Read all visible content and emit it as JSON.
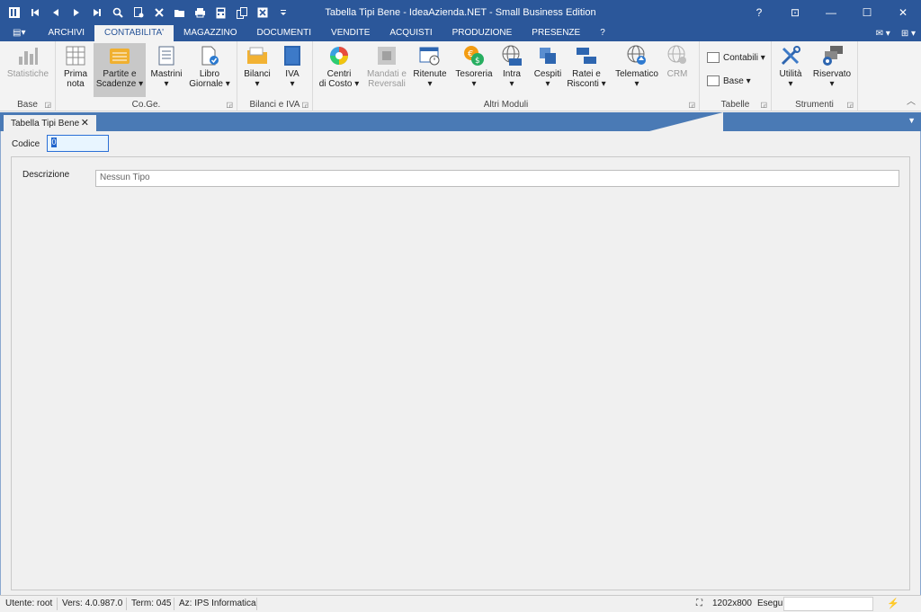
{
  "window": {
    "title": "Tabella Tipi Bene - IdeaAzienda.NET - Small Business Edition",
    "controls": [
      "?",
      "⊡",
      "—",
      "☐",
      "✕"
    ]
  },
  "quick_access": {
    "icons": [
      "app-icon",
      "first-icon",
      "prev-icon",
      "next-icon",
      "last-icon",
      "search-icon",
      "new-icon",
      "delete-icon",
      "folder-icon",
      "print-icon",
      "calc-icon",
      "copy-icon",
      "excel-icon",
      "customize-icon"
    ]
  },
  "ribbon_tabs": {
    "menu_glyph": "▤▾",
    "items": [
      "ARCHIVI",
      "CONTABILITA'",
      "MAGAZZINO",
      "DOCUMENTI",
      "VENDITE",
      "ACQUISTI",
      "PRODUZIONE",
      "PRESENZE",
      "?"
    ],
    "active": "CONTABILITA'",
    "right": [
      "✉ ▾",
      "⊞ ▾"
    ]
  },
  "ribbon": {
    "base": {
      "label": "Base",
      "statistiche": "Statistiche"
    },
    "coge": {
      "label": "Co.Ge.",
      "prima_nota_1": "Prima",
      "prima_nota_2": "nota",
      "partite_1": "Partite e",
      "partite_2": "Scadenze ▾",
      "mastrini_1": "Mastrini",
      "mastrini_2": "▾",
      "libro_1": "Libro",
      "libro_2": "Giornale ▾"
    },
    "bilanci_iva": {
      "label": "Bilanci e IVA",
      "bilanci_1": "Bilanci",
      "bilanci_2": "▾",
      "iva_1": "IVA",
      "iva_2": "▾"
    },
    "altri_moduli": {
      "label": "Altri Moduli",
      "centri_1": "Centri",
      "centri_2": "di Costo ▾",
      "mandati_1": "Mandati e",
      "mandati_2": "Reversali",
      "ritenute_1": "Ritenute",
      "ritenute_2": "▾",
      "tesoreria_1": "Tesoreria",
      "tesoreria_2": "▾",
      "intra_1": "Intra",
      "intra_2": "▾",
      "cespiti_1": "Cespiti",
      "cespiti_2": "▾",
      "ratei_1": "Ratei e",
      "ratei_2": "Risconti ▾",
      "telematico_1": "Telematico",
      "telematico_2": "▾",
      "crm": "CRM"
    },
    "tabelle": {
      "label": "Tabelle",
      "contabili": "Contabili ▾",
      "base": "Base ▾"
    },
    "strumenti": {
      "label": "Strumenti",
      "utilita_1": "Utilità",
      "utilita_2": "▾",
      "riservato_1": "Riservato",
      "riservato_2": "▾"
    }
  },
  "document_tab": {
    "label": "Tabella Tipi Bene",
    "close": "✕"
  },
  "form": {
    "codice_label": "Codice",
    "codice_value": "0",
    "descrizione_label": "Descrizione",
    "descrizione_value": "Nessun Tipo"
  },
  "statusbar": {
    "utente": "Utente: root",
    "vers": "Vers: 4.0.987.0",
    "term": "Term: 045",
    "az": "Az: IPS Informatica",
    "resolution": "1202x800",
    "esegui": "Esegui"
  }
}
